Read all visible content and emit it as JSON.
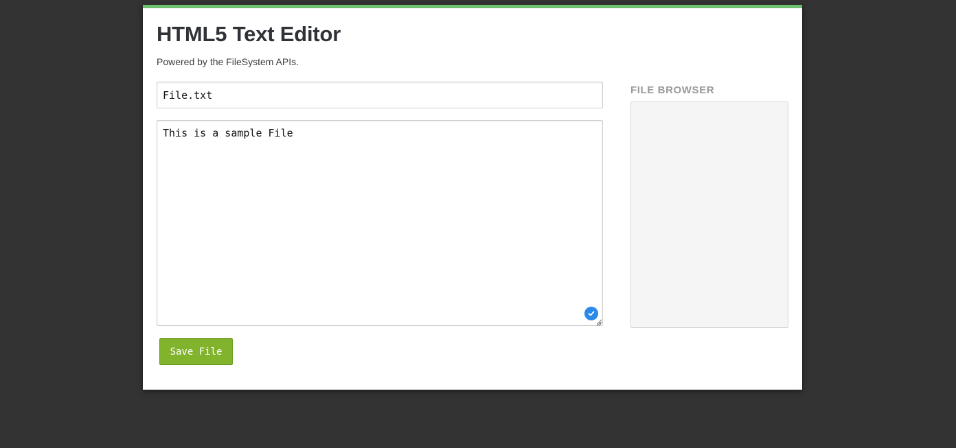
{
  "header": {
    "title": "HTML5 Text Editor",
    "subtitle": "Powered by the FileSystem APIs."
  },
  "editor": {
    "filename_value": "File.txt",
    "content_value": "This is a sample File",
    "save_label": "Save File"
  },
  "file_browser": {
    "heading": "FILE BROWSER",
    "items": []
  },
  "icons": {
    "check_badge": "check-circle-icon",
    "resize": "resize-grip-icon"
  },
  "colors": {
    "accent_bar": "#6cc070",
    "save_button": "#82b32c",
    "check_badge": "#2b8ae8",
    "background": "#333333"
  }
}
